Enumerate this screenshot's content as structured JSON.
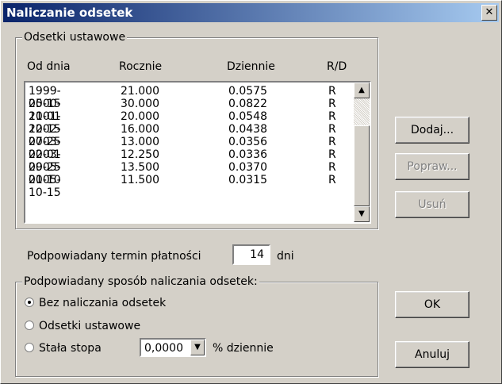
{
  "window": {
    "title": "Naliczanie odsetek",
    "close_glyph": "✕"
  },
  "odsetki_group": {
    "legend": "Odsetki ustawowe",
    "headers": [
      "Od dnia",
      "Rocznie",
      "Dziennie",
      "R/D"
    ],
    "rows": [
      [
        "1999-05-15",
        "21.000",
        "0.0575",
        "R"
      ],
      [
        "2000-11-01",
        "30.000",
        "0.0822",
        "R"
      ],
      [
        "2001-12-15",
        "20.000",
        "0.0548",
        "R"
      ],
      [
        "2002-07-25",
        "16.000",
        "0.0438",
        "R"
      ],
      [
        "2003-02-01",
        "13.000",
        "0.0356",
        "R"
      ],
      [
        "2003-09-25",
        "12.250",
        "0.0336",
        "R"
      ],
      [
        "2005-01-10",
        "13.500",
        "0.0370",
        "R"
      ],
      [
        "2005-10-15",
        "11.500",
        "0.0315",
        "R"
      ]
    ],
    "scroll_up_icon": "▲",
    "scroll_down_icon": "▼"
  },
  "buttons": {
    "dodaj": "Dodaj...",
    "popraw": "Popraw...",
    "usun": "Usuń",
    "ok": "OK",
    "anuluj": "Anuluj"
  },
  "termin": {
    "label": "Podpowiadany termin płatności",
    "value": "14",
    "unit": "dni"
  },
  "sposob_group": {
    "legend": "Podpowiadany sposób naliczania odsetek:",
    "options": [
      "Bez naliczania odsetek",
      "Odsetki ustawowe",
      "Stała stopa"
    ],
    "selected_index": 0,
    "stopa_value": "0,0000",
    "combo_icon": "▼",
    "stopa_unit": "% dziennie"
  }
}
